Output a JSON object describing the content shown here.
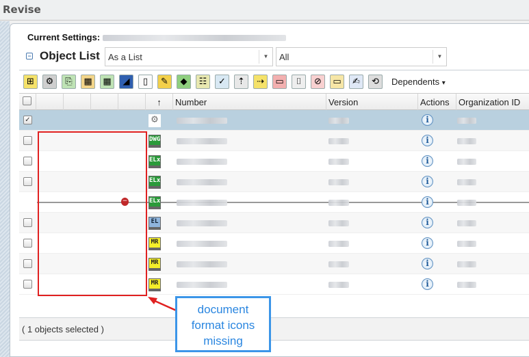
{
  "window": {
    "title": "Revise"
  },
  "settings": {
    "label": "Current Settings:"
  },
  "object_list": {
    "title": "Object List",
    "view_select": "As a List",
    "filter_select": "All"
  },
  "toolbar": {
    "icons": [
      "insert-structure",
      "add-configuration",
      "add-existing",
      "add-table",
      "add-table-2",
      "add-drawing",
      "new-document",
      "add-markup",
      "add-variant",
      "add-rows",
      "edit-rows",
      "move-up-insert",
      "move-right-insert",
      "remove",
      "brackets",
      "delete",
      "folder",
      "edit-checklist",
      "refresh"
    ],
    "dependents_label": "Dependents",
    "dependents_arrow": "▾"
  },
  "grid": {
    "columns": {
      "sort": "↑",
      "number": "Number",
      "version": "Version",
      "actions": "Actions",
      "org": "Organization ID"
    },
    "rows": [
      {
        "checked": true,
        "type": "config",
        "badge": "⚙"
      },
      {
        "checked": false,
        "type": "dwg",
        "badge": "DWG"
      },
      {
        "checked": false,
        "type": "elx",
        "badge": "ELx"
      },
      {
        "checked": false,
        "type": "elx",
        "badge": "ELx"
      },
      {
        "checked": null,
        "type": "elx",
        "badge": "ELx",
        "removed": true
      },
      {
        "checked": false,
        "type": "el",
        "badge": "EL"
      },
      {
        "checked": false,
        "type": "mr",
        "badge": "MR"
      },
      {
        "checked": false,
        "type": "mr",
        "badge": "MR"
      },
      {
        "checked": false,
        "type": "mr",
        "badge": "MR"
      }
    ],
    "info_glyph": "i"
  },
  "footer": {
    "status": "( 1 objects selected )"
  },
  "annotation": {
    "text_line1": "document",
    "text_line2": "format icons",
    "text_line3": "missing",
    "color_box": "#e02020",
    "color_callout": "#3b95e8"
  }
}
